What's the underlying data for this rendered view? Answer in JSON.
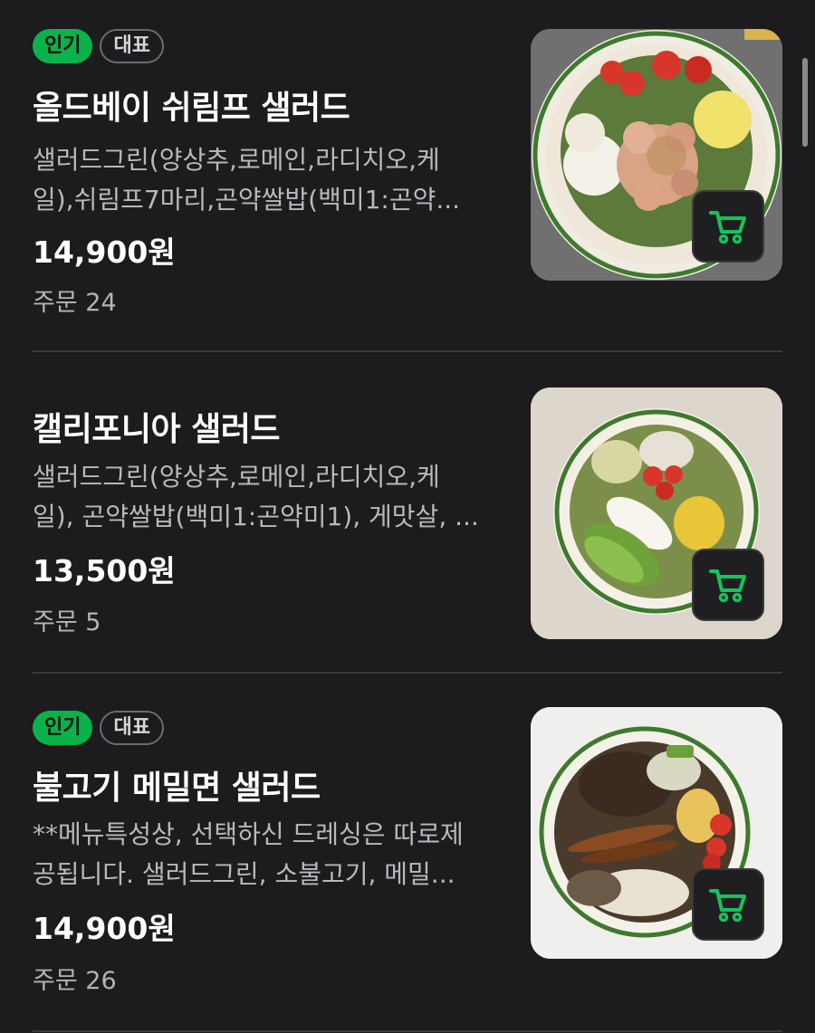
{
  "menu_items": [
    {
      "badges": [
        "인기",
        "대표"
      ],
      "name": "올드베이 쉬림프 샐러드",
      "description_line1": "샐러드그린(양상추,로메인,라디치오,케",
      "description_line2": "일),쉬림프7마리,곤약쌀밥(백미1:곤약...",
      "price": "14,900원",
      "orders": "주문 24"
    },
    {
      "badges": [],
      "name": "캘리포니아 샐러드",
      "description_line1": "샐러드그린(양상추,로메인,라디치오,케",
      "description_line2": "일), 곤약쌀밥(백미1:곤약미1), 게맛살, ...",
      "price": "13,500원",
      "orders": "주문 5"
    },
    {
      "badges": [
        "인기",
        "대표"
      ],
      "name": "불고기 메밀면 샐러드",
      "description_line1": "**메뉴특성상, 선택하신 드레싱은 따로제",
      "description_line2": "공됩니다. 샐러드그린, 소불고기, 메밀...",
      "price": "14,900원",
      "orders": "주문 26"
    }
  ],
  "colors": {
    "background": "#1c1c1e",
    "accent_green": "#09b24a",
    "divider": "#3a3a3c"
  },
  "icons": {
    "cart": "cart-icon"
  }
}
